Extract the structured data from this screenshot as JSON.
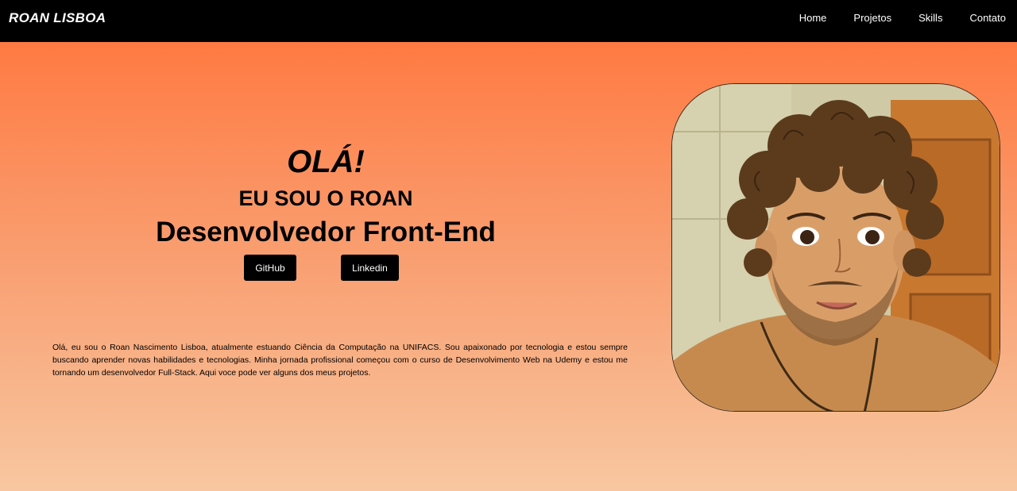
{
  "nav": {
    "brand": "ROAN LISBOA",
    "links": [
      "Home",
      "Projetos",
      "Skills",
      "Contato"
    ]
  },
  "hero": {
    "greeting": "OLÁ!",
    "intro": "EU SOU O ROAN",
    "role": "Desenvolvedor Front-End",
    "buttons": {
      "github": "GitHub",
      "linkedin": "Linkedin"
    },
    "about": "Olá, eu sou o Roan Nascimento Lisboa, atualmente estuando Ciência da Computação na UNIFACS. Sou apaixonado por tecnologia e estou sempre buscando aprender novas habilidades e tecnologias. Minha jornada profissional começou com o curso de Desenvolvimento Web na Udemy e estou me tornando um desenvolvedor Full-Stack. Aqui voce pode ver alguns dos meus projetos."
  },
  "colors": {
    "nav_bg": "#000000",
    "gradient_top": "#ff7a42",
    "gradient_bottom": "#f8c7a0",
    "button_bg": "#000000"
  }
}
